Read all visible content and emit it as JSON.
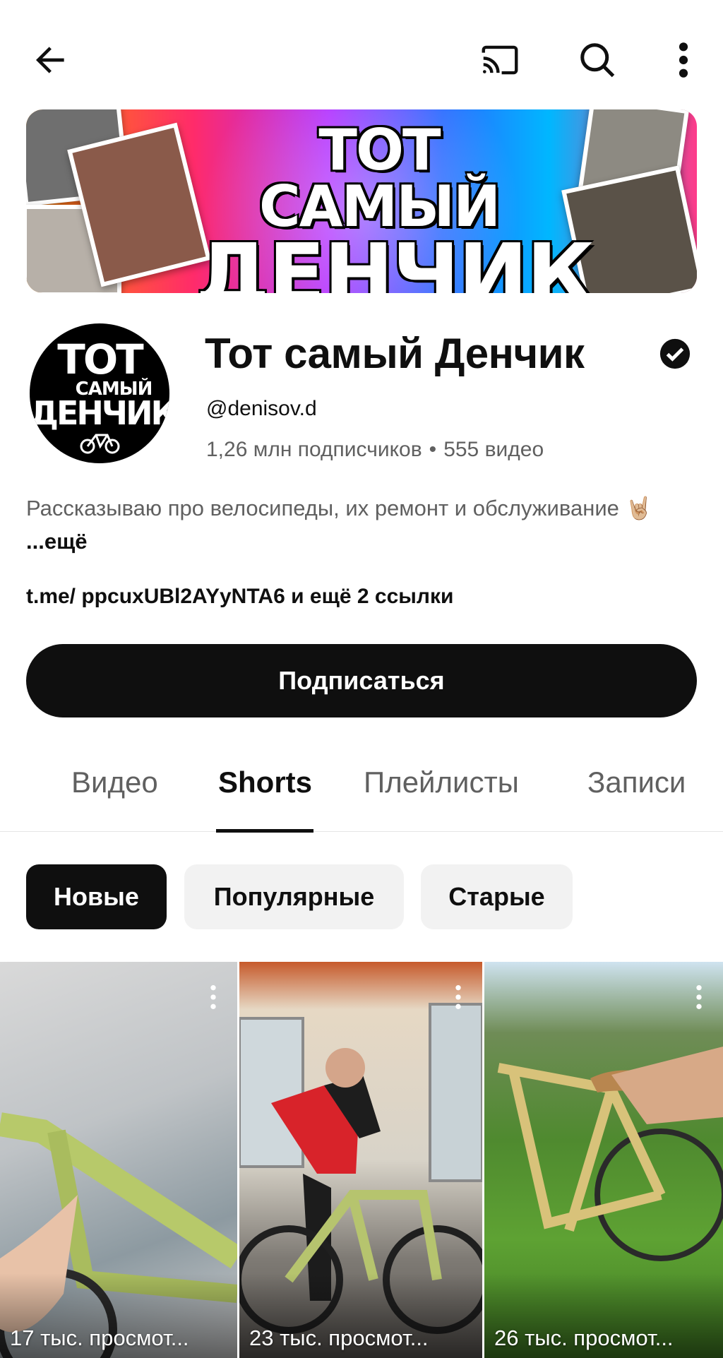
{
  "topbar": {
    "icons": [
      "back-arrow-icon",
      "cast-icon",
      "search-icon",
      "more-vertical-icon"
    ]
  },
  "banner": {
    "line1": "ТОТ САМЫЙ",
    "line2": "ДЕНЧИК"
  },
  "avatar": {
    "line1": "ТОТ",
    "line2": "САМЫЙ",
    "line3": "ДЕНЧИК"
  },
  "channel": {
    "name": "Тот самый Денчик",
    "handle": "@denisov.d",
    "subscribers": "1,26 млн подписчиков",
    "separator": "•",
    "videos": "555 видео",
    "description": "Рассказываю про велосипеды, их ремонт и обслуживание 🤘🏼",
    "more": "...ещё",
    "links": "t.me/ ppcuxUBl2AYyNTA6 и ещё 2 ссылки",
    "subscribe_label": "Подписаться"
  },
  "tabs": [
    {
      "label": "Видео",
      "active": false
    },
    {
      "label": "Shorts",
      "active": true
    },
    {
      "label": "Плейлисты",
      "active": false
    },
    {
      "label": "Записи",
      "active": false
    }
  ],
  "chips": [
    {
      "label": "Новые",
      "selected": true
    },
    {
      "label": "Популярные",
      "selected": false
    },
    {
      "label": "Старые",
      "selected": false
    }
  ],
  "shorts": [
    {
      "views": "17 тыс. просмот..."
    },
    {
      "views": "23 тыс. просмот..."
    },
    {
      "views": "26 тыс. просмот..."
    }
  ],
  "colors": {
    "text_primary": "#0f0f0f",
    "text_secondary": "#606060",
    "chip_bg": "#f2f2f2",
    "button_bg": "#0f0f0f"
  }
}
